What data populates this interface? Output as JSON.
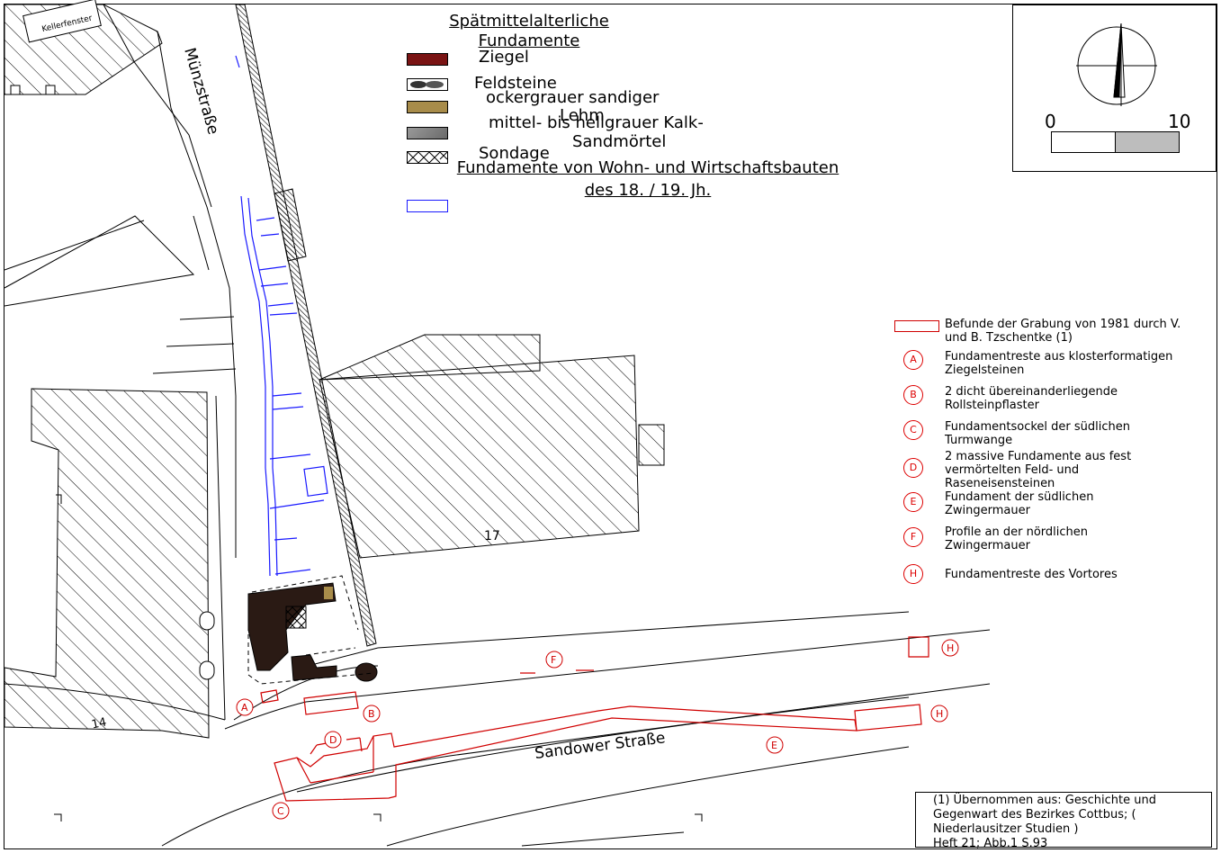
{
  "legend": {
    "title_line1": "Spätmittelalterliche",
    "title_line2": "Fundamente",
    "items": [
      {
        "label": "Ziegel",
        "color": "#7a1414"
      },
      {
        "label": "Feldsteine",
        "color": "#555555"
      },
      {
        "label": "ockergrauer sandiger",
        "label2": "Lehm",
        "color": "#a88c4a"
      },
      {
        "label": "mittel- bis hellgrauer Kalk-",
        "label2": "Sandmörtel",
        "color": "#8a8a8a"
      },
      {
        "label": "Sondage",
        "color": "#ffffff"
      }
    ],
    "modern_line1": "Fundamente von Wohn- und Wirtschaftsbauten",
    "modern_line2": "des 18. / 19. Jh.",
    "modern_color": "#1a1aff"
  },
  "scale": {
    "min": "0",
    "max": "10"
  },
  "streets": {
    "muenzstrasse": "Münzstraße",
    "sandower": "Sandower Straße"
  },
  "plot_numbers": {
    "n17": "17",
    "n14": "14"
  },
  "map_labels": {
    "kellerfenster": "Kellerfenster"
  },
  "finds_legend": {
    "excavation": "Befunde der Grabung von 1981 durch V. und B. Tzschentke  (1)",
    "excavation_color": "#d00000",
    "items": [
      {
        "letter": "A",
        "text": "Fundamentreste aus klosterformatigen Ziegelsteinen"
      },
      {
        "letter": "B",
        "text": "2 dicht übereinanderliegende Rollsteinpflaster"
      },
      {
        "letter": "C",
        "text": "Fundamentsockel der südlichen Turmwange"
      },
      {
        "letter": "D",
        "text": "2 massive Fundamente aus fest vermörtelten Feld- und Raseneisensteinen"
      },
      {
        "letter": "E",
        "text": "Fundament der südlichen Zwingermauer"
      },
      {
        "letter": "F",
        "text": "Profile an der nördlichen Zwingermauer"
      },
      {
        "letter": "H",
        "text": "Fundamentreste des Vortores"
      }
    ]
  },
  "source": {
    "line1": "(1)  Übernommen aus: Geschichte und",
    "line2": "Gegenwart des Bezirkes Cottbus; (",
    "line3": "Niederlausitzer Studien )",
    "line4": "Heft 21;  Abb.1 S.93"
  }
}
